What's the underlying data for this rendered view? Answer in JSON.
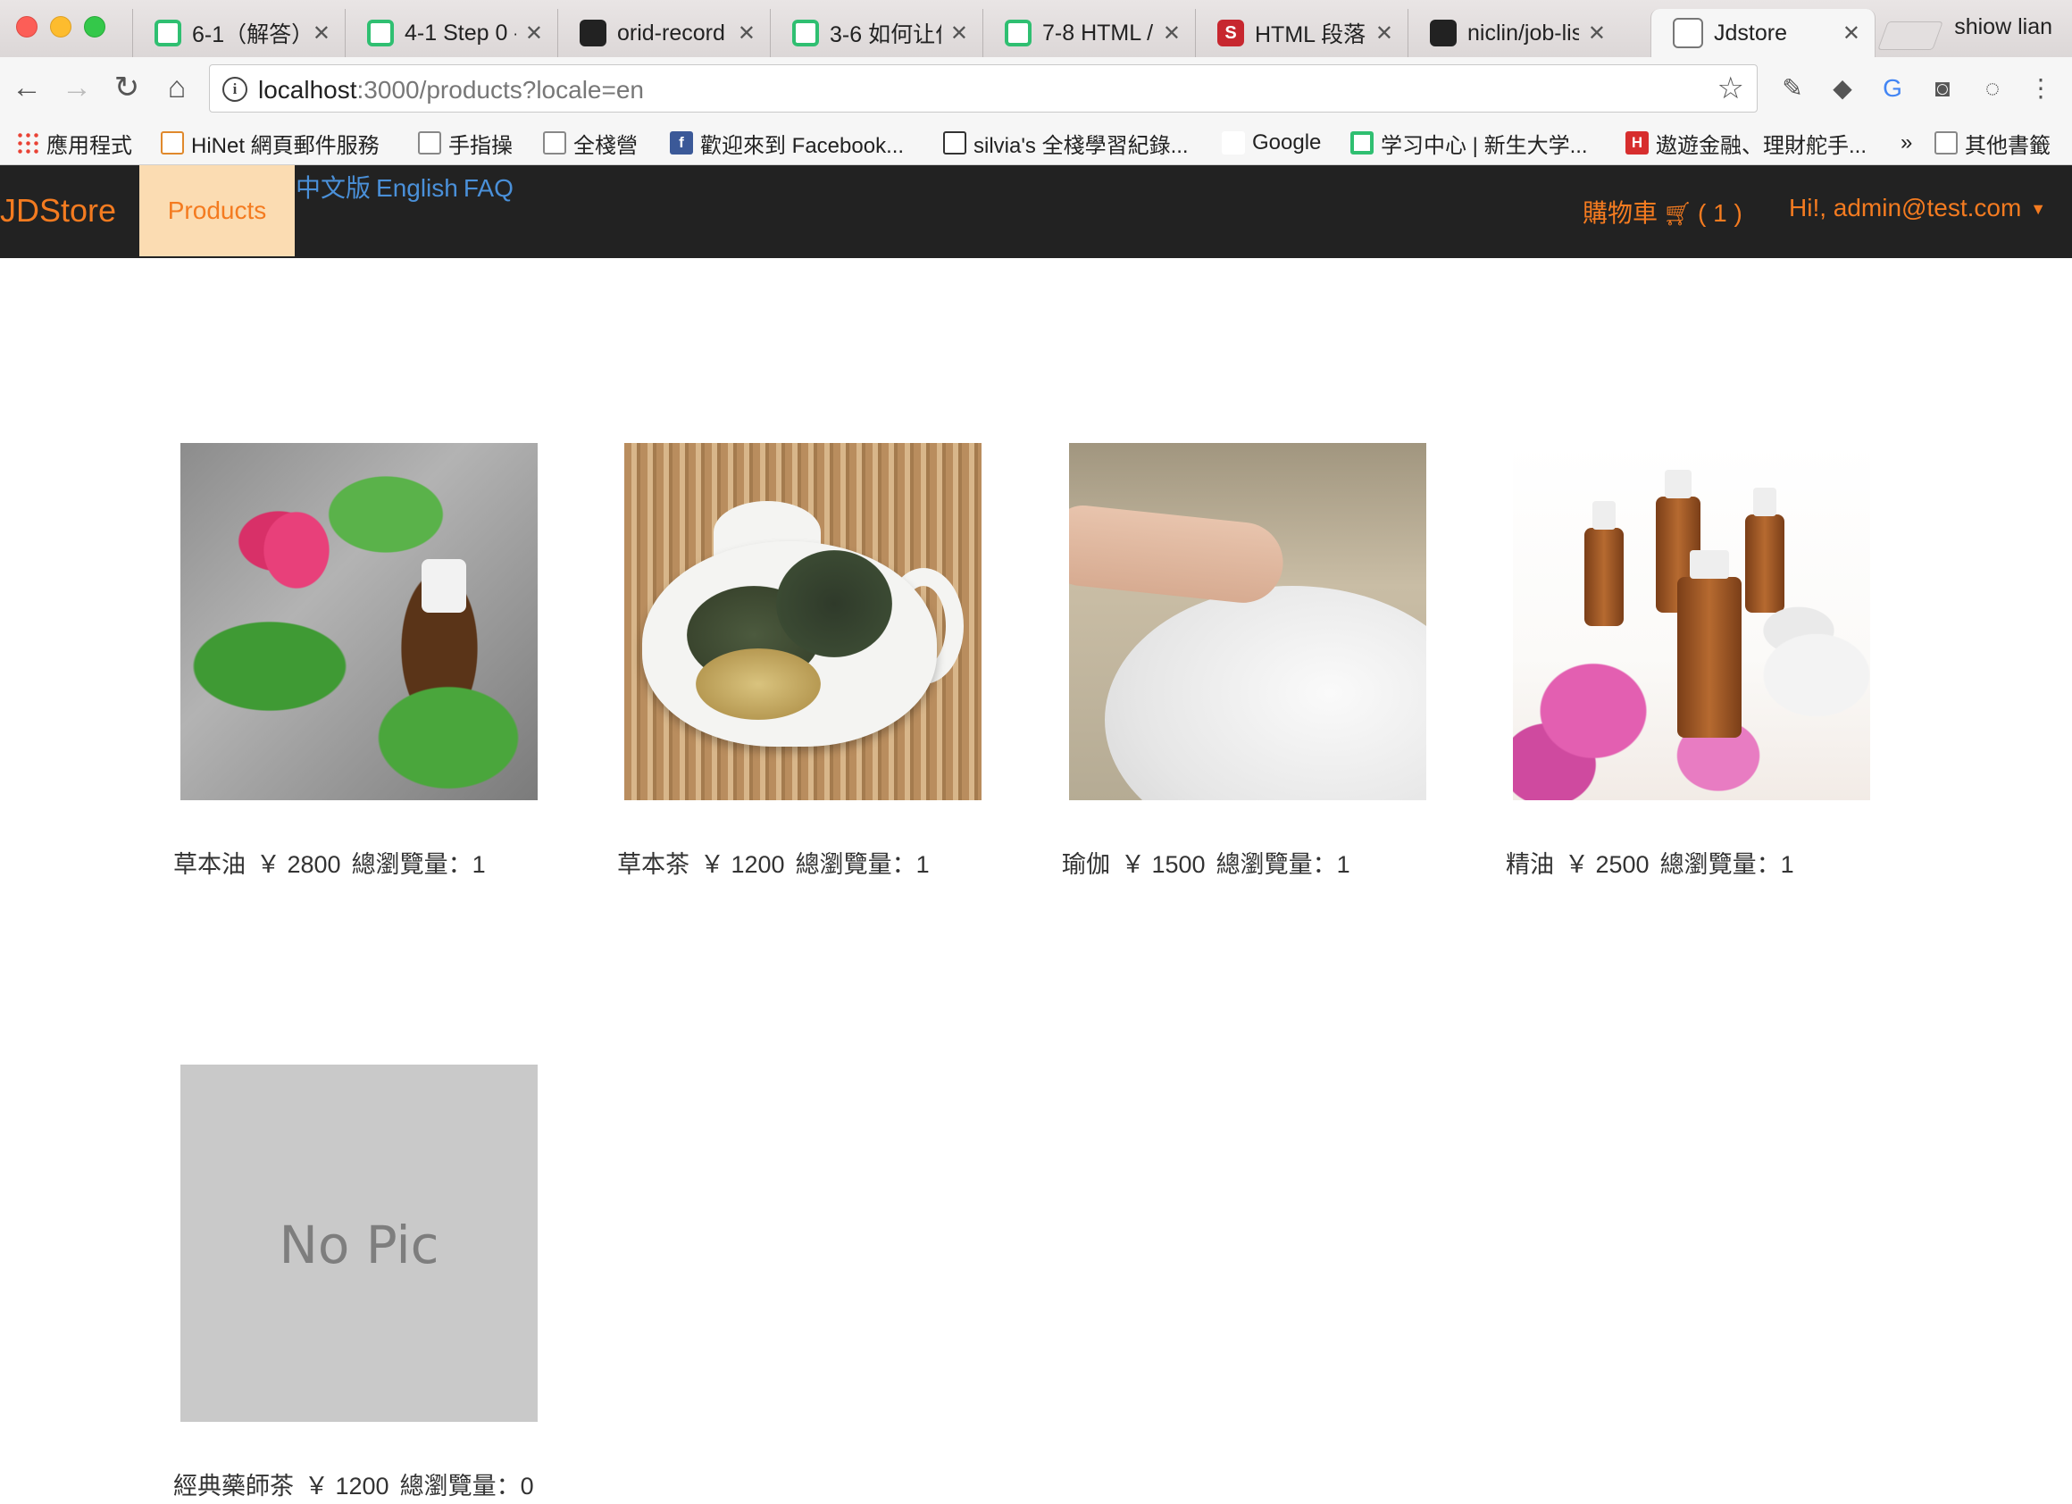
{
  "browser": {
    "tabs": [
      {
        "title": "6-1（解答）",
        "icon": "green-logo-icon"
      },
      {
        "title": "4-1 Step 0 -",
        "icon": "green-logo-icon"
      },
      {
        "title": "orid-record",
        "icon": "github-icon"
      },
      {
        "title": "3-6 如何让作",
        "icon": "green-logo-icon"
      },
      {
        "title": "7-8 HTML /",
        "icon": "green-logo-icon"
      },
      {
        "title": "HTML 段落",
        "icon": "red-s-icon"
      },
      {
        "title": "niclin/job-lis",
        "icon": "github-icon"
      },
      {
        "title": "Jdstore",
        "icon": "document-icon"
      }
    ],
    "profile_name": "shiow lian",
    "url_host": "localhost",
    "url_rest": ":3000/products?locale=en",
    "bookmarks": [
      {
        "label": "應用程式",
        "icon": "apps-grid-icon"
      },
      {
        "label": "HiNet 網頁郵件服務",
        "icon": "mail-icon"
      },
      {
        "label": "手指操",
        "icon": "folder-icon"
      },
      {
        "label": "全棧營",
        "icon": "folder-icon"
      },
      {
        "label": "歡迎來到 Facebook...",
        "icon": "facebook-icon"
      },
      {
        "label": "silvia's 全棧學習紀錄...",
        "icon": "silvia-icon"
      },
      {
        "label": "Google",
        "icon": "google-icon"
      },
      {
        "label": "学习中心 | 新生大学...",
        "icon": "green-logo-icon"
      },
      {
        "label": "遨遊金融、理財舵手...",
        "icon": "red-logo-icon"
      },
      {
        "label": "其他書籤",
        "icon": "folder-icon"
      }
    ],
    "bookmarks_overflow": "»"
  },
  "site": {
    "brand": "JDStore",
    "nav_products": "Products",
    "locale_zh": "中文版",
    "locale_en": "English",
    "faq": "FAQ",
    "cart_label": "購物車",
    "cart_count": "( 1 )",
    "user_label": "Hi!, admin@test.com",
    "accent_color": "#f47b20",
    "navbar_color": "#222222"
  },
  "products": [
    {
      "name": "草本油",
      "price": "￥ 2800",
      "views": "總瀏覽量：1",
      "image": "herbal-oil"
    },
    {
      "name": "草本茶",
      "price": "￥ 1200",
      "views": "總瀏覽量：1",
      "image": "herbal-tea"
    },
    {
      "name": "瑜伽",
      "price": "￥ 1500",
      "views": "總瀏覽量：1",
      "image": "yoga"
    },
    {
      "name": "精油",
      "price": "￥ 2500",
      "views": "總瀏覽量：1",
      "image": "essential-oil"
    },
    {
      "name": "經典藥師茶",
      "price": "￥ 1200",
      "views": "總瀏覽量：0",
      "image": "no-pic",
      "placeholder_text": "No Pic"
    }
  ]
}
